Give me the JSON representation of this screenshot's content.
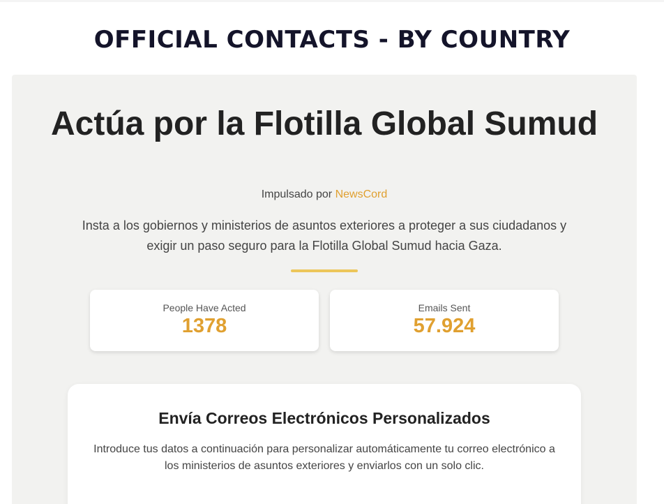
{
  "page": {
    "title": "OFFICIAL CONTACTS - BY COUNTRY"
  },
  "hero": {
    "title": "Actúa por la Flotilla Global Sumud",
    "powered_prefix": "Impulsado por",
    "powered_brand": "NewsCord",
    "description": "Insta a los gobiernos y ministerios de asuntos exteriores a proteger a sus ciudadanos y exigir un paso seguro para la Flotilla Global Sumud hacia Gaza."
  },
  "stats": [
    {
      "label": "People Have Acted",
      "value": "1378"
    },
    {
      "label": "Emails Sent",
      "value": "57.924"
    }
  ],
  "email_form": {
    "title": "Envía Correos Electrónicos Personalizados",
    "description": "Introduce tus datos a continuación para personalizar automáticamente tu correo electrónico a los ministerios de asuntos exteriores y enviarlos con un solo clic."
  },
  "colors": {
    "accent": "#e0a030",
    "divider": "#ecc65a",
    "panel_bg": "#f2f2f0",
    "title_text": "#14142a"
  }
}
